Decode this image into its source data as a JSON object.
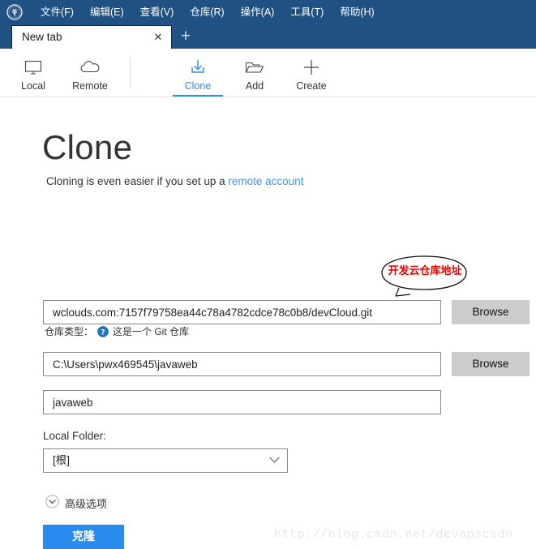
{
  "window": {
    "logo_icon": "sourcetree-logo-icon",
    "menu": [
      {
        "label": "文件(F)"
      },
      {
        "label": "编辑(E)"
      },
      {
        "label": "查看(V)"
      },
      {
        "label": "仓库(R)"
      },
      {
        "label": "操作(A)"
      },
      {
        "label": "工具(T)"
      },
      {
        "label": "帮助(H)"
      }
    ],
    "accent_color": "#1f5182"
  },
  "tabs": {
    "items": [
      {
        "label": "New tab",
        "close_icon": "close-icon",
        "active": true
      }
    ],
    "new_tab_icon": "plus-icon"
  },
  "toolbar": {
    "buttons": [
      {
        "label": "Local",
        "icon": "monitor-icon",
        "active": false
      },
      {
        "label": "Remote",
        "icon": "cloud-icon",
        "active": false
      },
      {
        "label": "Clone",
        "icon": "download-tray-icon",
        "active": true
      },
      {
        "label": "Add",
        "icon": "open-folder-icon",
        "active": false
      },
      {
        "label": "Create",
        "icon": "plus-icon",
        "active": false
      }
    ],
    "active_color": "#2b8cf0"
  },
  "main": {
    "title": "Clone",
    "subtitle_prefix": "Cloning is even easier if you set up a ",
    "subtitle_link": "remote account",
    "annotation": {
      "text": "开发云仓库地址",
      "color": "#e60000",
      "shape": "hand-drawn-ellipse-with-pointer"
    },
    "source_url": {
      "value": "wclouds.com:7157f79758ea44c78a4782cdce78c0b8/devCloud.git",
      "placeholder": "URL",
      "browse_label": "Browse"
    },
    "repo_type": {
      "label": "仓库类型：",
      "help_icon": "help-circle-icon",
      "value": "这是一个 Git 仓库"
    },
    "destination_path": {
      "value": "C:\\Users\\pwx469545\\javaweb",
      "placeholder": "Destination Path",
      "browse_label": "Browse"
    },
    "name": {
      "value": "javaweb",
      "placeholder": "Name"
    },
    "local_folder": {
      "label": "Local Folder:",
      "value": "[根]",
      "chevron_icon": "chevron-down-icon"
    },
    "advanced": {
      "label": "高级选项",
      "icon": "chevron-down-circle-icon"
    },
    "clone_button": {
      "label": "克隆",
      "color": "#2b8cf0"
    }
  },
  "watermark": {
    "text": "http://blog.csdn.net/devopscsdn"
  }
}
